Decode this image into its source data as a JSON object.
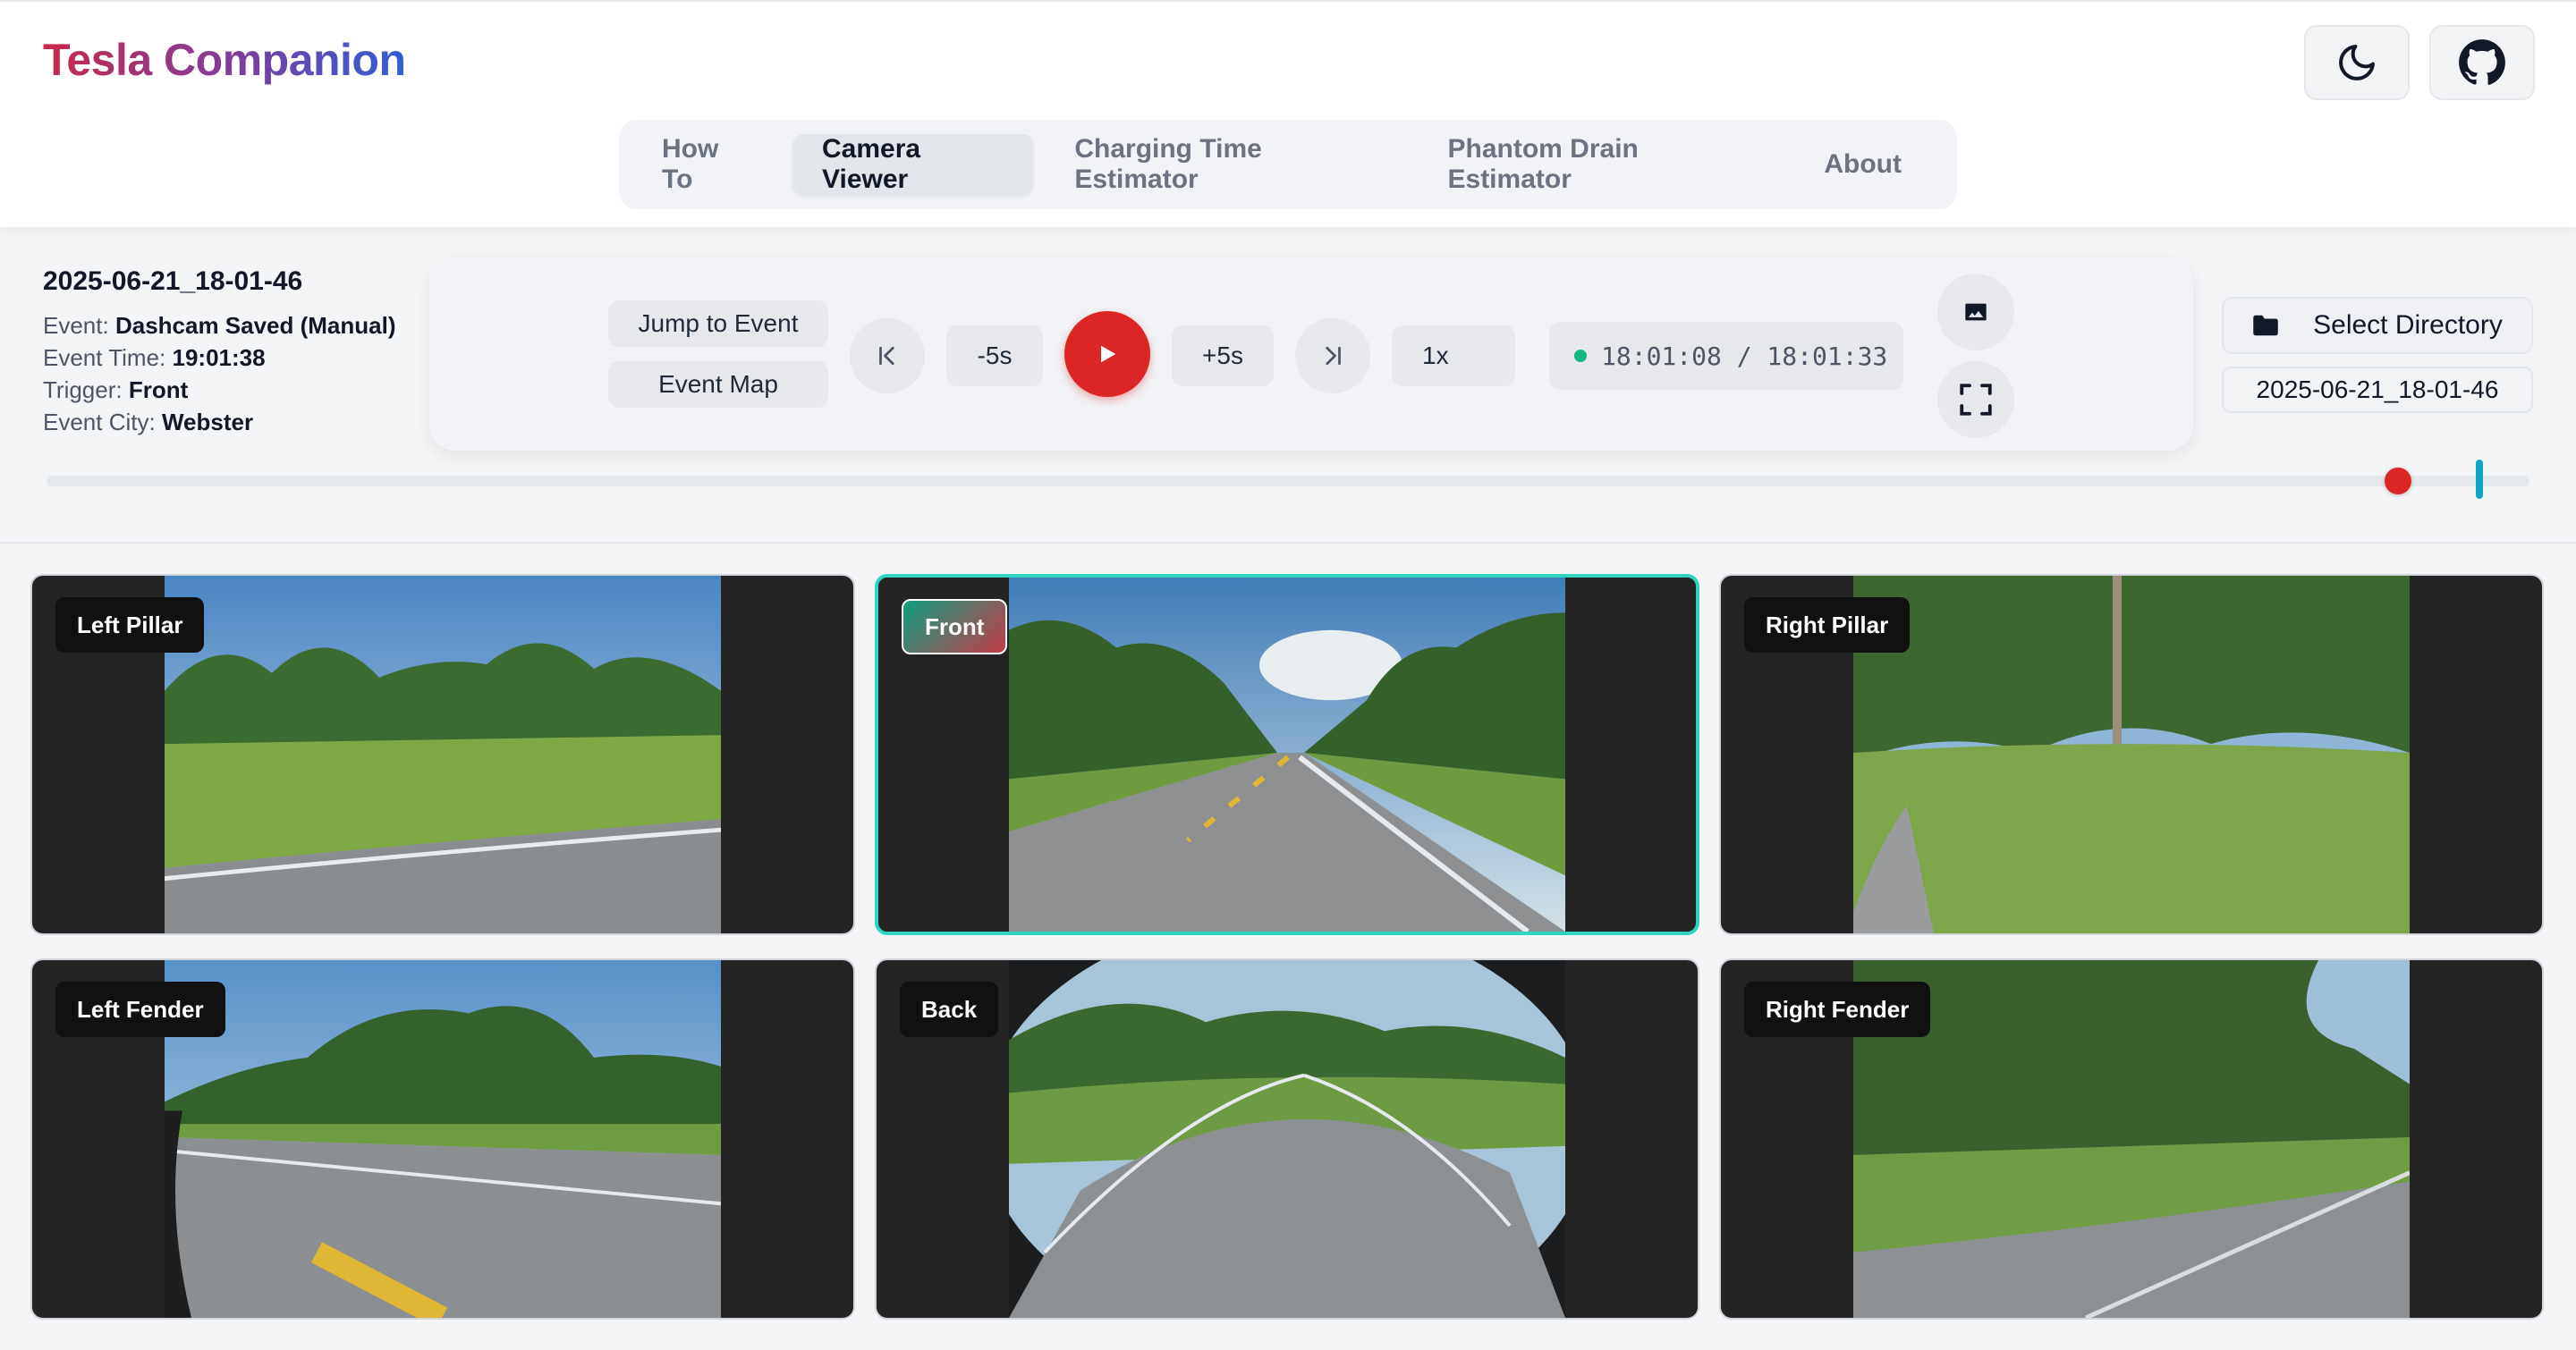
{
  "app": {
    "title": "Tesla Companion"
  },
  "header": {
    "theme_toggle_icon": "moon-icon",
    "github_icon": "github-icon"
  },
  "nav": {
    "tabs": [
      {
        "label": "How To",
        "active": false
      },
      {
        "label": "Camera Viewer",
        "active": true
      },
      {
        "label": "Charging Time Estimator",
        "active": false
      },
      {
        "label": "Phantom Drain Estimator",
        "active": false
      },
      {
        "label": "About",
        "active": false
      }
    ]
  },
  "event": {
    "title": "2025-06-21_18-01-46",
    "rows": [
      {
        "key": "Event:",
        "value": "Dashcam Saved (Manual)"
      },
      {
        "key": "Event Time:",
        "value": "19:01:38"
      },
      {
        "key": "Trigger:",
        "value": "Front"
      },
      {
        "key": "Event City:",
        "value": "Webster"
      }
    ]
  },
  "player": {
    "jump_to_event": "Jump to Event",
    "event_map": "Event Map",
    "back_5": "-5s",
    "fwd_5": "+5s",
    "speed": "1x",
    "time_display": "18:01:08 / 18:01:33",
    "status_color": "#10b981",
    "play_color": "#dc2626",
    "progress": 0.947,
    "event_marker": 0.98
  },
  "directory": {
    "select_label": "Select Directory",
    "current": "2025-06-21_18-01-46"
  },
  "cameras": [
    {
      "label": "Left Pillar",
      "active": false
    },
    {
      "label": "Front",
      "active": true
    },
    {
      "label": "Right Pillar",
      "active": false
    },
    {
      "label": "Left Fender",
      "active": false
    },
    {
      "label": "Back",
      "active": false
    },
    {
      "label": "Right Fender",
      "active": false
    }
  ]
}
